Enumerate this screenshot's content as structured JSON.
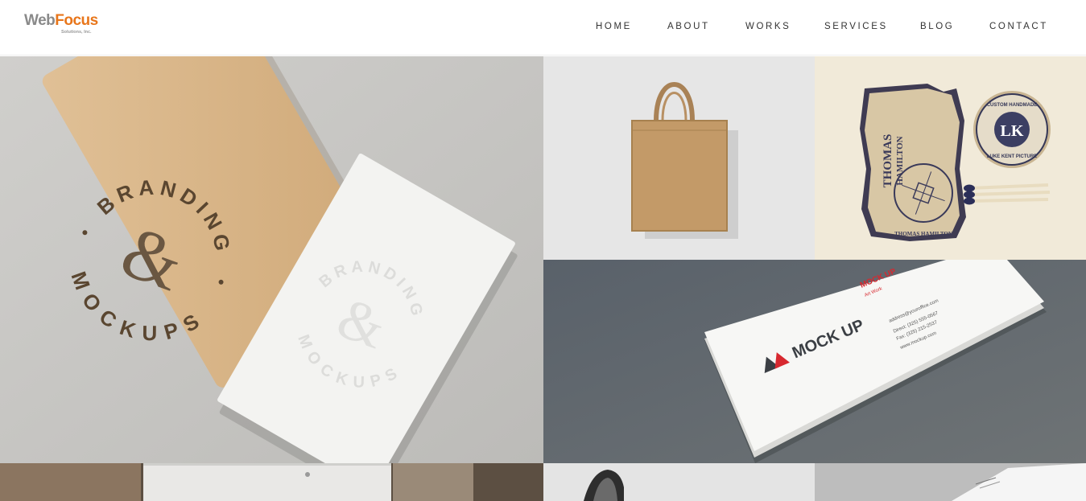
{
  "header": {
    "logo": {
      "primary": "Web",
      "accent": "Focus",
      "subtitle": "Solutions, Inc."
    },
    "nav": [
      {
        "label": "HOME"
      },
      {
        "label": "ABOUT"
      },
      {
        "label": "WORKS"
      },
      {
        "label": "SERVICES"
      },
      {
        "label": "BLOG"
      },
      {
        "label": "CONTACT"
      }
    ]
  },
  "portfolio": {
    "branding": {
      "top_text": "BRANDING",
      "bottom_text": "MOCKUPS",
      "ampersand": "&"
    },
    "vintage": {
      "card_name": "THOMAS",
      "card_surname": "HAMILTON",
      "badge_initials": "LK",
      "badge_top": "CUSTOM HANDMADE",
      "badge_bottom": "LUKE KENT PICTURE",
      "seal_text": "THOMAS HAMILTON"
    },
    "business_card": {
      "title": "MOCK UP",
      "corner_title": "MOCK UP",
      "corner_sub": "Art Work",
      "email": "address@youroffice.com",
      "direct": "Direct: (325) 555-0567",
      "fax": "Fax: (325) 215-2537",
      "web": "www.mockup.com"
    }
  },
  "colors": {
    "logo_gray": "#8a8a8a",
    "logo_orange": "#e8761b",
    "nav_text": "#333333",
    "mock_red": "#d7282f"
  }
}
